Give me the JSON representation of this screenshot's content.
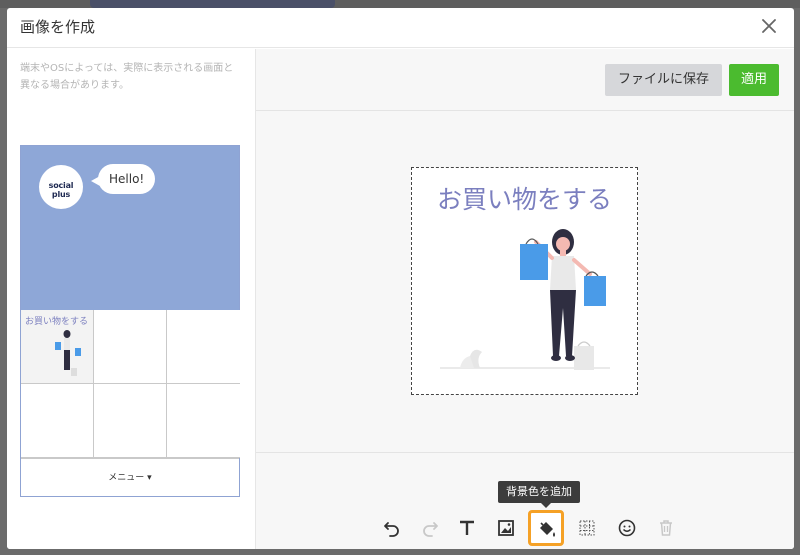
{
  "modal": {
    "title": "画像を作成"
  },
  "notice": "端末やOSによっては、実際に表示される画面と異なる場合があります。",
  "preview": {
    "avatar_text": "social plus",
    "bubble_text": "Hello!",
    "cell_label": "お買い物をする",
    "menu_label": "メニュー ▾"
  },
  "toolbar": {
    "save_label": "ファイルに保存",
    "apply_label": "適用",
    "tooltip": "背景色を追加",
    "tools": [
      "undo-icon",
      "redo-icon",
      "text-icon",
      "image-icon",
      "paint-bucket-icon",
      "grid-icon",
      "emoji-icon",
      "trash-icon"
    ]
  },
  "canvas": {
    "title": "お買い物をする"
  },
  "colors": {
    "accent_green": "#4bbb2f",
    "preview_blue": "#8ea7d7",
    "title_purple": "#7b7fbf",
    "highlight_orange": "#f5a126",
    "bag_blue": "#4a9be8"
  }
}
